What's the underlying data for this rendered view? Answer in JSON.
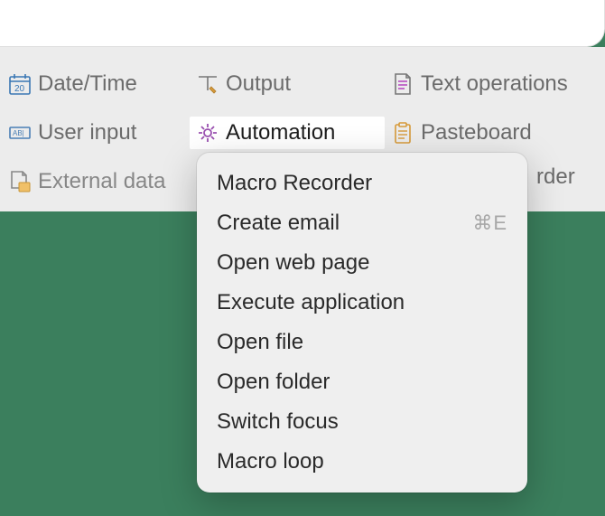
{
  "toolbar": {
    "row1": [
      {
        "label": "Date/Time"
      },
      {
        "label": "Output"
      },
      {
        "label": "Text operations"
      }
    ],
    "row2": [
      {
        "label": "User input"
      },
      {
        "label": "Automation"
      },
      {
        "label": "Pasteboard"
      }
    ],
    "row3": [
      {
        "label": "External data"
      }
    ],
    "partial_visible": "rder"
  },
  "menu": {
    "items": [
      {
        "label": "Macro Recorder",
        "shortcut": ""
      },
      {
        "label": "Create email",
        "shortcut": "⌘E"
      },
      {
        "label": "Open web page",
        "shortcut": ""
      },
      {
        "label": "Execute application",
        "shortcut": ""
      },
      {
        "label": "Open file",
        "shortcut": ""
      },
      {
        "label": "Open folder",
        "shortcut": ""
      },
      {
        "label": "Switch focus",
        "shortcut": ""
      },
      {
        "label": "Macro loop",
        "shortcut": ""
      }
    ]
  }
}
